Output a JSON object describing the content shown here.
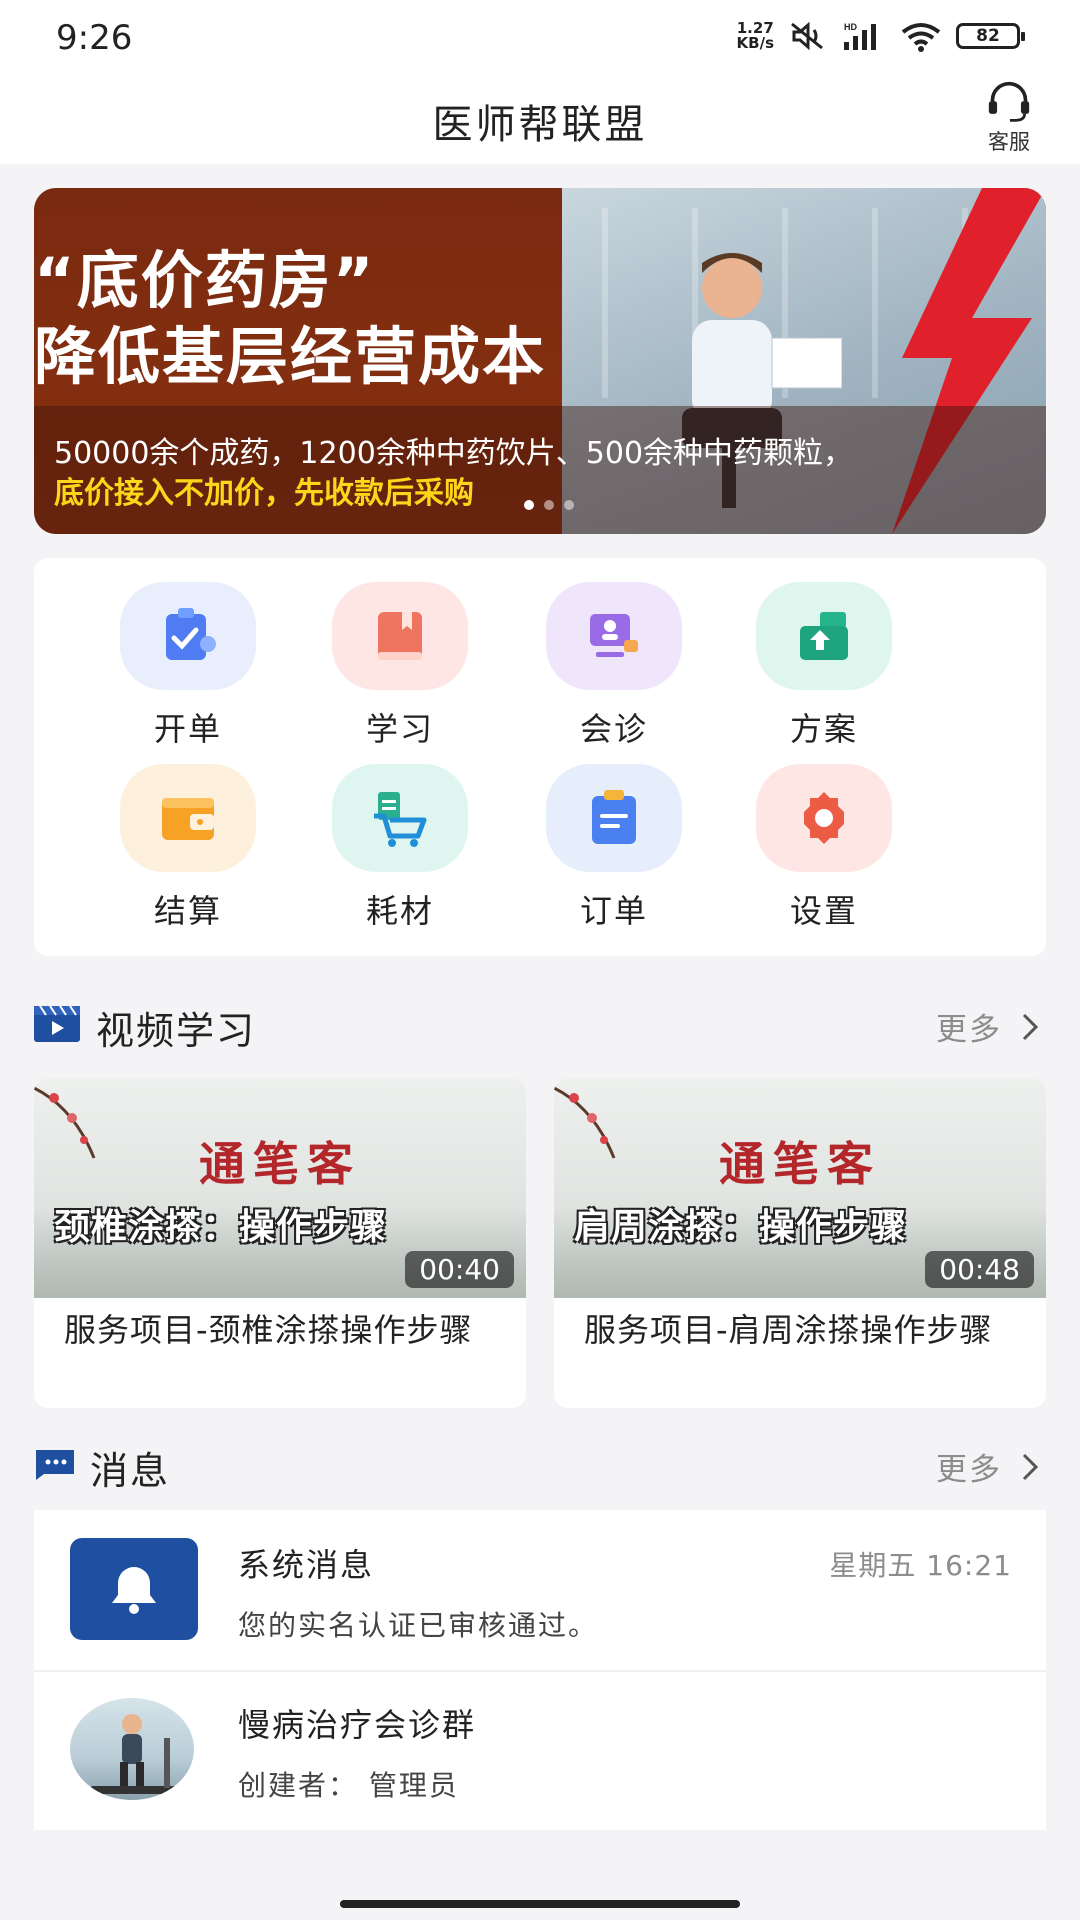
{
  "status_bar": {
    "time": "9:26",
    "speed_value": "1.27",
    "speed_unit": "KB/s",
    "battery": "82"
  },
  "header": {
    "title": "医师帮联盟",
    "support_label": "客服"
  },
  "banner": {
    "title_line1": "“底价药房”",
    "title_line2": "降低基层经营成本",
    "desc_line1": "50000余个成药，1200余种中药饮片、500余种中药颗粒，",
    "desc_line2": "底价接入不加价，先收款后采购"
  },
  "shortcuts": [
    {
      "label": "开单",
      "icon": "prescription-icon",
      "color": "#e9eefc"
    },
    {
      "label": "学习",
      "icon": "book-icon",
      "color": "#fde6e3"
    },
    {
      "label": "会诊",
      "icon": "consultation-icon",
      "color": "#efe6fb"
    },
    {
      "label": "方案",
      "icon": "plan-box-icon",
      "color": "#dff6ef"
    },
    {
      "label": "结算",
      "icon": "wallet-icon",
      "color": "#fdf0dc"
    },
    {
      "label": "耗材",
      "icon": "cart-icon",
      "color": "#dff5ef"
    },
    {
      "label": "订单",
      "icon": "order-icon",
      "color": "#e6eefc"
    },
    {
      "label": "设置",
      "icon": "settings-icon",
      "color": "#fde6e3"
    }
  ],
  "video_section": {
    "title": "视频学习",
    "more": "更多",
    "videos": [
      {
        "brand": "通笔客",
        "overlay": "颈椎涂搽：操作步骤",
        "duration": "00:40",
        "title": "服务项目-颈椎涂搽操作步骤"
      },
      {
        "brand": "通笔客",
        "overlay": "肩周涂搽：操作步骤",
        "duration": "00:48",
        "title": "服务项目-肩周涂搽操作步骤"
      }
    ]
  },
  "message_section": {
    "title": "消息",
    "more": "更多",
    "messages": [
      {
        "title": "系统消息",
        "time": "星期五 16:21",
        "body": "您的实名认证已审核通过。"
      },
      {
        "title": "慢病治疗会诊群",
        "time": "",
        "body": "创建者： 管理员"
      }
    ]
  },
  "colors": {
    "brand_blue": "#1f4fa0",
    "banner_red": "#7a2a10",
    "banner_yellow": "#ffd51c"
  }
}
